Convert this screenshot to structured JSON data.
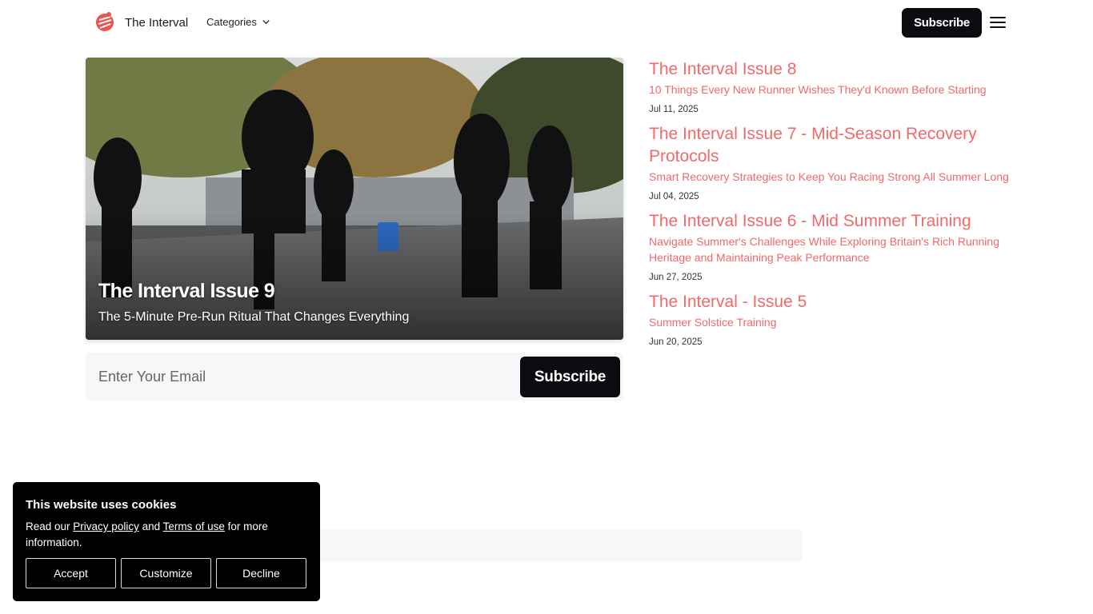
{
  "header": {
    "brand": "The Interval",
    "categories_label": "Categories",
    "subscribe_label": "Subscribe",
    "logo_icon": "runner-logo-icon",
    "menu_icon": "hamburger-icon"
  },
  "hero": {
    "title": "The Interval Issue 9",
    "subtitle": "The 5-Minute Pre-Run Ritual That Changes Everything"
  },
  "email_form": {
    "placeholder": "Enter Your Email",
    "subscribe_label": "Subscribe"
  },
  "articles": [
    {
      "title": "The Interval Issue 8",
      "subtitle": "10 Things Every New Runner Wishes They'd Known Before Starting",
      "date": "Jul 11, 2025"
    },
    {
      "title": "The Interval Issue 7 - Mid-Season Recovery Protocols",
      "subtitle": "Smart Recovery Strategies to Keep You Racing Strong All Summer Long",
      "date": "Jul 04, 2025"
    },
    {
      "title": "The Interval Issue 6 - Mid Summer Training",
      "subtitle": "Navigate Summer's Challenges While Exploring Britain's Rich Running Heritage and Maintaining Peak Performance",
      "date": "Jun 27, 2025"
    },
    {
      "title": "The Interval - Issue 5",
      "subtitle": "Summer Solstice Training",
      "date": "Jun 20, 2025"
    }
  ],
  "cookie": {
    "title": "This website uses cookies",
    "text_prefix": "Read our ",
    "privacy_link": "Privacy policy",
    "text_and": " and ",
    "terms_link": "Terms of use",
    "text_suffix": " for more information.",
    "accept_label": "Accept",
    "customize_label": "Customize",
    "decline_label": "Decline"
  },
  "colors": {
    "accent": "#ef6a6a",
    "button_dark": "#0b0c10"
  }
}
